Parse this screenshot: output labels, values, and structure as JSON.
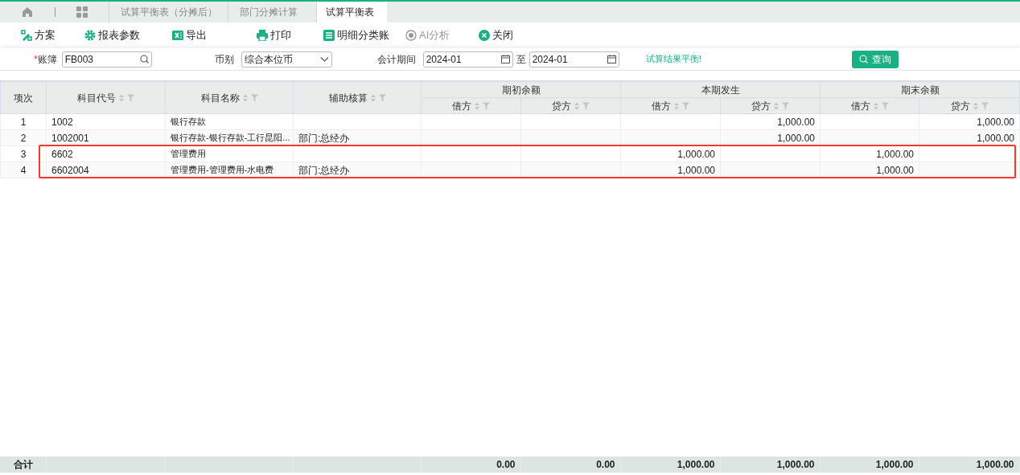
{
  "tabs": [
    {
      "label": "试算平衡表（分摊后）",
      "selected": false
    },
    {
      "label": "部门分摊计算",
      "selected": false
    },
    {
      "label": "试算平衡表",
      "selected": true
    }
  ],
  "toolbar": [
    {
      "label": "方案",
      "kind": "scheme",
      "disabled": false
    },
    {
      "label": "报表参数",
      "kind": "gear",
      "disabled": false
    },
    {
      "label": "导出",
      "kind": "excel",
      "disabled": false
    },
    {
      "label": "打印",
      "kind": "print",
      "disabled": false
    },
    {
      "label": "明细分类账",
      "kind": "ledger",
      "disabled": false
    },
    {
      "label": "AI分析",
      "kind": "ai",
      "disabled": true
    },
    {
      "label": "关闭",
      "kind": "close",
      "disabled": false
    }
  ],
  "filters": {
    "ledger": {
      "required_mark": "*",
      "label": "账簿",
      "value": "FB003"
    },
    "currency": {
      "label": "币别",
      "value": "综合本位币"
    },
    "period": {
      "label": "会计期间",
      "from": "2024-01",
      "to_label": "至",
      "to": "2024-01"
    },
    "message": "试算结果平衡!",
    "query_button": "查询"
  },
  "table": {
    "columns": [
      "项次",
      "科目代号",
      "科目名称",
      "辅助核算"
    ],
    "groups": [
      {
        "label": "期初余额",
        "columns": [
          "借方",
          "贷方"
        ]
      },
      {
        "label": "本期发生",
        "columns": [
          "借方",
          "贷方"
        ]
      },
      {
        "label": "期末余额",
        "columns": [
          "借方",
          "贷方"
        ]
      }
    ],
    "rows": [
      {
        "cells": [
          "1",
          "1002",
          "银行存款",
          "",
          "",
          "",
          "",
          "1,000.00",
          "",
          "1,000.00"
        ],
        "highlighted": false
      },
      {
        "cells": [
          "2",
          "1002001",
          "银行存款-银行存款-工行昆阳...",
          "部门:总经办",
          "",
          "",
          "",
          "1,000.00",
          "",
          "1,000.00"
        ],
        "highlighted": false
      },
      {
        "cells": [
          "3",
          "6602",
          "管理费用",
          "",
          "",
          "",
          "1,000.00",
          "",
          "1,000.00",
          ""
        ],
        "highlighted": true
      },
      {
        "cells": [
          "4",
          "6602004",
          "管理费用-管理费用-水电费",
          "部门:总经办",
          "",
          "",
          "1,000.00",
          "",
          "1,000.00",
          ""
        ],
        "highlighted": true
      }
    ],
    "footer": {
      "label": "合计",
      "values": [
        "0.00",
        "0.00",
        "1,000.00",
        "1,000.00",
        "1,000.00",
        "1,000.00"
      ]
    }
  }
}
